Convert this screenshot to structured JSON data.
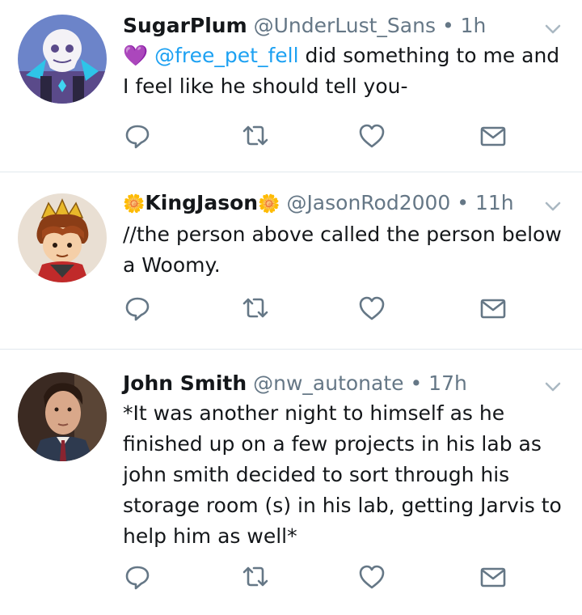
{
  "tweets": [
    {
      "name": "SugarPlum",
      "handle": "@UnderLust_Sans",
      "separator": "•",
      "time": "1h",
      "emoji": "💜",
      "mention": "@free_pet_fell",
      "text": " did something to me and I feel like he should tell you-"
    },
    {
      "name_prefix": "🌼",
      "name": "KingJason",
      "name_suffix": "🌼",
      "handle": "@JasonRod2000",
      "separator": "•",
      "time": "11h",
      "text": "//the person above called the person below a Woomy."
    },
    {
      "name": "John Smith",
      "handle": "@nw_autonate",
      "separator": "•",
      "time": "17h",
      "text": "*It was another night to himself as he finished up on a few projects in his lab as john smith decided to sort through his storage room (s) in his lab, getting Jarvis to help him as well*"
    }
  ],
  "icons": {
    "reply": "reply-icon",
    "retweet": "retweet-icon",
    "like": "heart-icon",
    "message": "envelope-icon",
    "menu": "chevron-down-icon"
  },
  "colors": {
    "text": "#14171a",
    "muted": "#657786",
    "link": "#1da1f2",
    "divider": "#e1e8ed",
    "heart_emoji": "#a25cd8"
  }
}
